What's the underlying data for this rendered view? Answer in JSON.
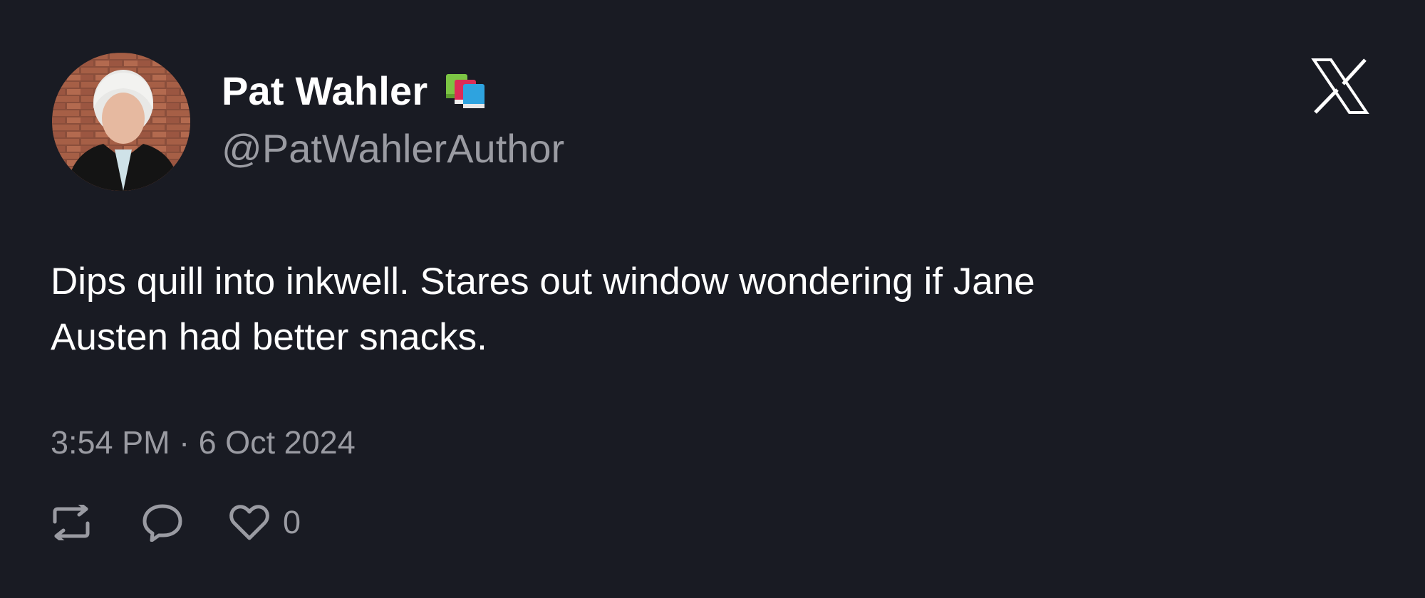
{
  "author": {
    "display_name": "Pat Wahler",
    "handle": "@PatWahlerAuthor",
    "name_emoji_icon": "books-icon",
    "avatar_icon": "profile-photo"
  },
  "tweet": {
    "text": "Dips quill into inkwell. Stares out window wondering if Jane\nAusten had better snacks.",
    "timestamp": "3:54 PM · 6 Oct 2024"
  },
  "actions": {
    "retweet_icon": "retweet-icon",
    "reply_icon": "reply-icon",
    "like_icon": "heart-icon",
    "like_count": "0"
  },
  "brand": {
    "logo_icon": "x-logo-icon"
  },
  "colors": {
    "background": "#191b23",
    "primary_text": "#ffffff",
    "secondary_text": "#9a9ba2"
  }
}
